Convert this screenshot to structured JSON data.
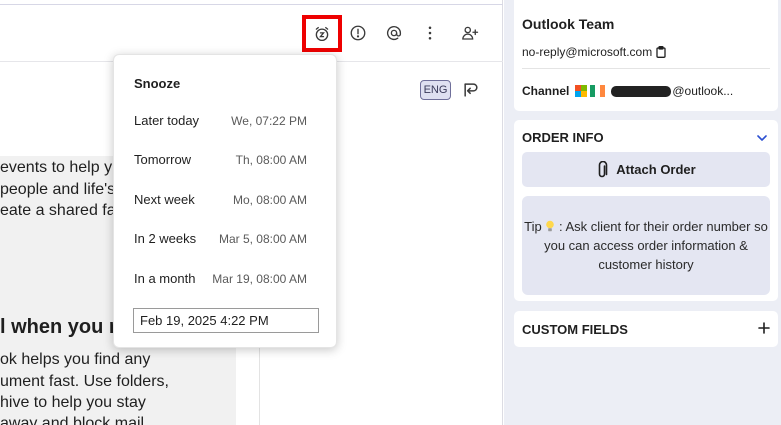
{
  "email": {
    "lang_badge": "ENG",
    "lines_top": [
      "events to help y",
      "people and life's",
      "eate a shared fa"
    ],
    "heading": "l when you r",
    "lines_bottom": [
      "ok helps you find any",
      "ument fast. Use folders,",
      "hive to help you stay",
      "away and block mail"
    ]
  },
  "snooze": {
    "title": "Snooze",
    "options": [
      {
        "label": "Later today",
        "when": "We, 07:22 PM"
      },
      {
        "label": "Tomorrow",
        "when": "Th, 08:00 AM"
      },
      {
        "label": "Next week",
        "when": "Mo, 08:00 AM"
      },
      {
        "label": "In 2 weeks",
        "when": "Mar 5, 08:00 AM"
      },
      {
        "label": "In a month",
        "when": "Mar 19, 08:00 AM"
      }
    ],
    "datetime_value": "Feb 19, 2025 4:22 PM"
  },
  "contact": {
    "name": "Outlook Team",
    "email": "no-reply@microsoft.com",
    "channel_label": "Channel",
    "channel_value": "@outlook..."
  },
  "order_info": {
    "title": "ORDER INFO",
    "attach_label": "Attach Order",
    "tip_prefix": "Tip",
    "tip_text": ": Ask client for their order number so you can access order information & customer history"
  },
  "custom_fields": {
    "title": "CUSTOM FIELDS"
  },
  "colors": {
    "highlight": "#ee0000",
    "accent": "#2b4fd1",
    "sidebar_bg": "#eceef5"
  }
}
